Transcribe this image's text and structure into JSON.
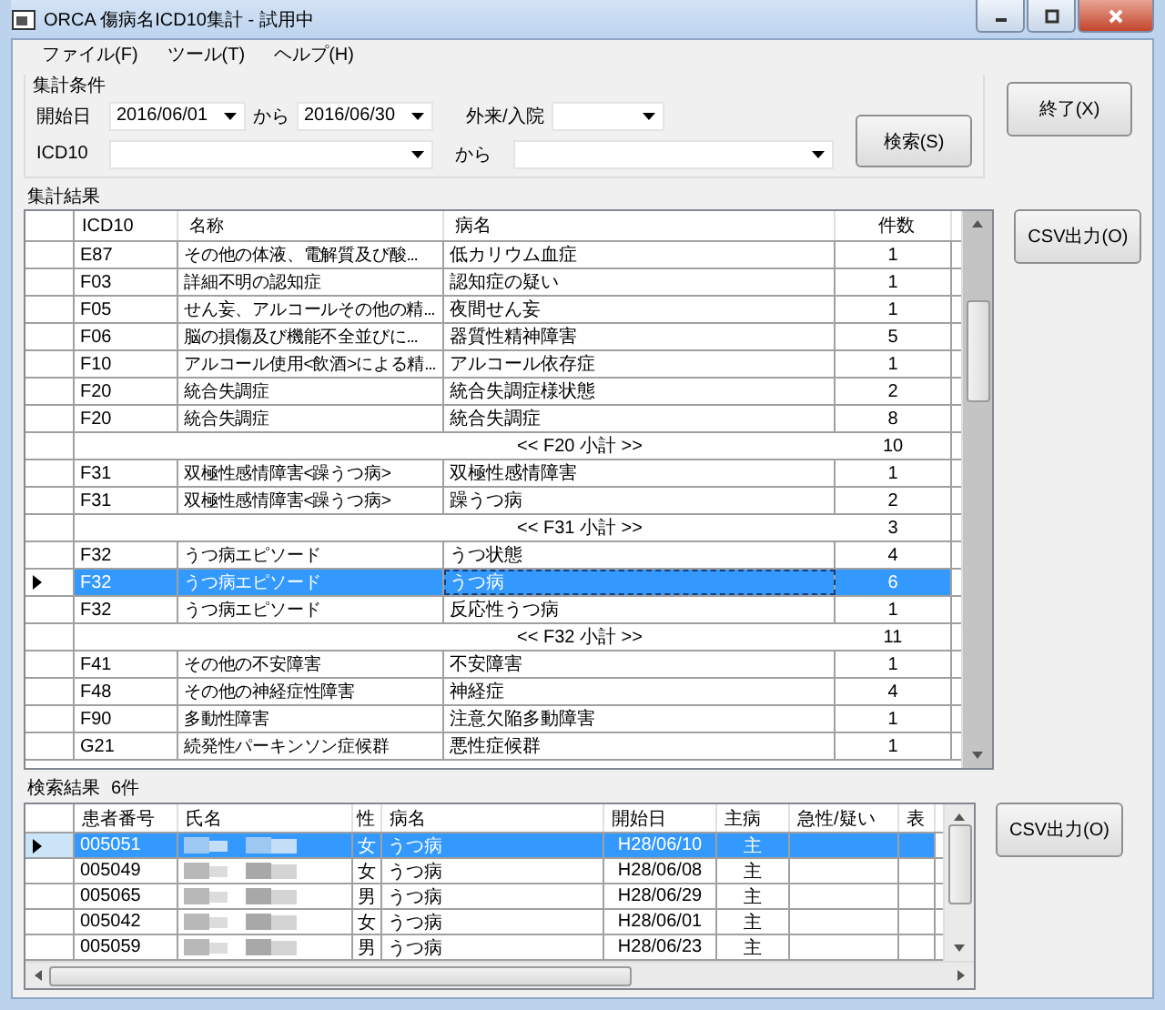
{
  "window": {
    "title": "ORCA 傷病名ICD10集計 - 試用中"
  },
  "menu": [
    "ファイル(F)",
    "ツール(T)",
    "ヘルプ(H)"
  ],
  "criteria": {
    "title": "集計条件",
    "start_label": "開始日",
    "start": "2016/06/01",
    "from1": "から",
    "end": "2016/06/30",
    "type_label": "外来/入院",
    "icd_label": "ICD10",
    "from2": "から"
  },
  "search_button": "検索(S)",
  "exit_button": "終了(X)",
  "summary": {
    "title": "集計結果",
    "csv_button": "CSV出力(O)",
    "columns": [
      "ICD10",
      "名称",
      "病名",
      "件数"
    ],
    "rows": [
      {
        "kind": "item",
        "icd": "E87",
        "name": "その他の体液、電解質及び酸...",
        "disease": "低カリウム血症",
        "count": "1",
        "selected": false
      },
      {
        "kind": "item",
        "icd": "F03",
        "name": "詳細不明の認知症",
        "disease": "認知症の疑い",
        "count": "1",
        "selected": false
      },
      {
        "kind": "item",
        "icd": "F05",
        "name": "せん妄、アルコールその他の精...",
        "disease": "夜間せん妄",
        "count": "1",
        "selected": false
      },
      {
        "kind": "item",
        "icd": "F06",
        "name": "脳の損傷及び機能不全並びに...",
        "disease": "器質性精神障害",
        "count": "5",
        "selected": false
      },
      {
        "kind": "item",
        "icd": "F10",
        "name": "アルコール使用<飲酒>による精...",
        "disease": "アルコール依存症",
        "count": "1",
        "selected": false
      },
      {
        "kind": "item",
        "icd": "F20",
        "name": "統合失調症",
        "disease": "統合失調症様状態",
        "count": "2",
        "selected": false
      },
      {
        "kind": "item",
        "icd": "F20",
        "name": "統合失調症",
        "disease": "統合失調症",
        "count": "8",
        "selected": false
      },
      {
        "kind": "subtotal",
        "disease": "<<  F20 小計  >>",
        "count": "10",
        "selected": false
      },
      {
        "kind": "item",
        "icd": "F31",
        "name": "双極性感情障害<躁うつ病>",
        "disease": "双極性感情障害",
        "count": "1",
        "selected": false
      },
      {
        "kind": "item",
        "icd": "F31",
        "name": "双極性感情障害<躁うつ病>",
        "disease": "躁うつ病",
        "count": "2",
        "selected": false
      },
      {
        "kind": "subtotal",
        "disease": "<<  F31 小計  >>",
        "count": "3",
        "selected": false
      },
      {
        "kind": "item",
        "icd": "F32",
        "name": "うつ病エピソード",
        "disease": "うつ状態",
        "count": "4",
        "selected": false
      },
      {
        "kind": "item",
        "icd": "F32",
        "name": "うつ病エピソード",
        "disease": "うつ病",
        "count": "6",
        "selected": true
      },
      {
        "kind": "item",
        "icd": "F32",
        "name": "うつ病エピソード",
        "disease": "反応性うつ病",
        "count": "1",
        "selected": false
      },
      {
        "kind": "subtotal",
        "disease": "<<  F32 小計  >>",
        "count": "11",
        "selected": false
      },
      {
        "kind": "item",
        "icd": "F41",
        "name": "その他の不安障害",
        "disease": "不安障害",
        "count": "1",
        "selected": false
      },
      {
        "kind": "item",
        "icd": "F48",
        "name": "その他の神経症性障害",
        "disease": "神経症",
        "count": "4",
        "selected": false
      },
      {
        "kind": "item",
        "icd": "F90",
        "name": "多動性障害",
        "disease": "注意欠陥多動障害",
        "count": "1",
        "selected": false
      },
      {
        "kind": "item",
        "icd": "G21",
        "name": "続発性パーキンソン症候群",
        "disease": "悪性症候群",
        "count": "1",
        "selected": false
      }
    ]
  },
  "results": {
    "title": "検索結果",
    "count": "6件",
    "csv_button": "CSV出力(O)",
    "columns": [
      "患者番号",
      "氏名",
      "性",
      "病名",
      "開始日",
      "主病",
      "急性/疑い",
      "表"
    ],
    "rows": [
      {
        "id": "005051",
        "sex": "女",
        "disease": "うつ病",
        "start": "H28/06/10",
        "main": "主",
        "selected": true
      },
      {
        "id": "005049",
        "sex": "女",
        "disease": "うつ病",
        "start": "H28/06/08",
        "main": "主",
        "selected": false
      },
      {
        "id": "005065",
        "sex": "男",
        "disease": "うつ病",
        "start": "H28/06/29",
        "main": "主",
        "selected": false
      },
      {
        "id": "005042",
        "sex": "女",
        "disease": "うつ病",
        "start": "H28/06/01",
        "main": "主",
        "selected": false
      },
      {
        "id": "005059",
        "sex": "男",
        "disease": "うつ病",
        "start": "H28/06/23",
        "main": "主",
        "selected": false
      }
    ]
  }
}
